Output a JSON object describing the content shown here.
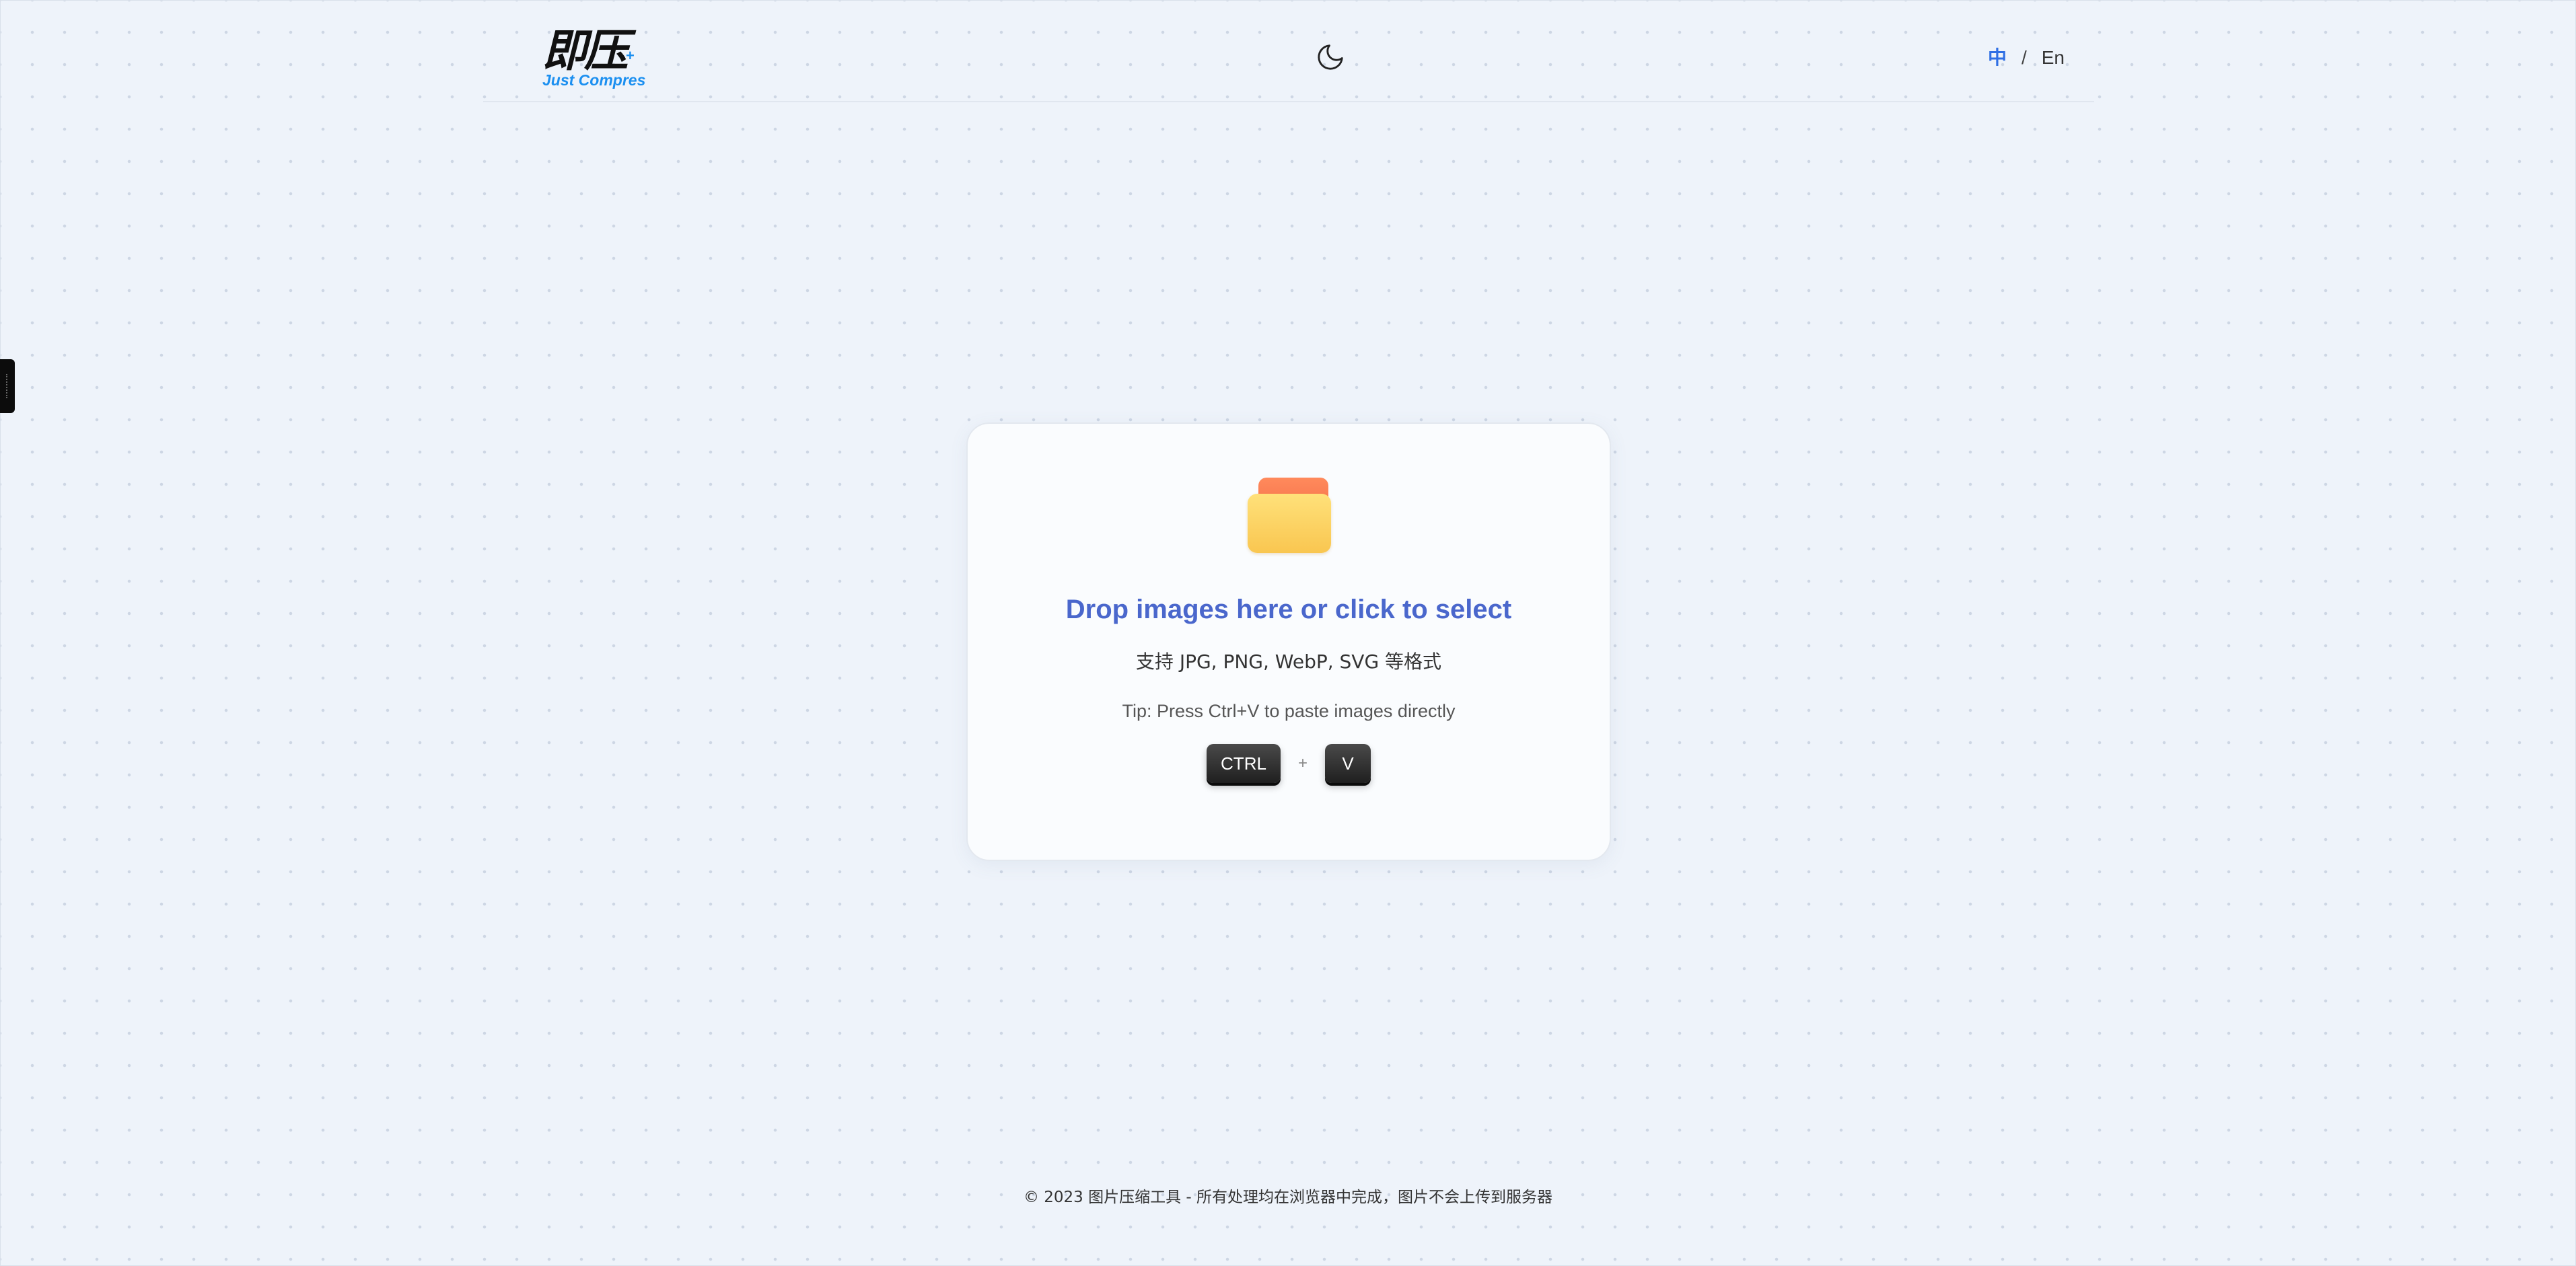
{
  "header": {
    "logo_cn": "即压",
    "logo_en": "Just Compres",
    "theme_icon": "moon-icon",
    "lang": {
      "zh": "中",
      "separator": "/",
      "en": "En",
      "active": "zh"
    }
  },
  "upload": {
    "icon": "folder-icon",
    "title": "Drop images here or click to select",
    "formats": "支持 JPG, PNG, WebP, SVG 等格式",
    "tip": "Tip: Press Ctrl+V to paste images directly",
    "keys": {
      "ctrl": "CTRL",
      "plus": "+",
      "v": "V"
    }
  },
  "footer": {
    "text": "© 2023 图片压缩工具 - 所有处理均在浏览器中完成，图片不会上传到服务器"
  },
  "colors": {
    "accent": "#4a67cc",
    "logo_blue": "#1b8ff0",
    "lang_active": "#2f6fe4",
    "background": "#eef3fa"
  }
}
